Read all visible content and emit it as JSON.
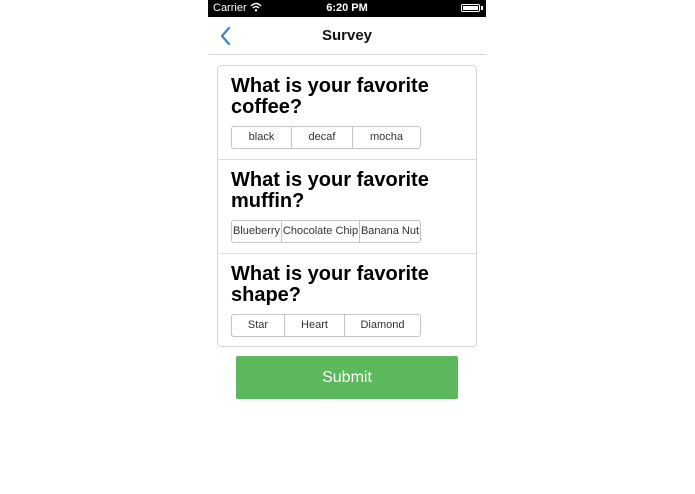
{
  "status_bar": {
    "carrier": "Carrier",
    "time": "6:20 PM",
    "wifi_icon": "wifi-icon",
    "battery_icon": "battery-icon"
  },
  "nav": {
    "title": "Survey",
    "back_icon": "chevron-left-icon"
  },
  "questions": [
    {
      "text": "What is your favorite coffee?",
      "options": [
        "black",
        "decaf",
        "mocha"
      ]
    },
    {
      "text": "What is your favorite muffin?",
      "options": [
        "Blueberry",
        "Chocolate Chip",
        "Banana Nut"
      ]
    },
    {
      "text": "What is your favorite shape?",
      "options": [
        "Star",
        "Heart",
        "Diamond"
      ]
    }
  ],
  "submit_label": "Submit",
  "colors": {
    "accent": "#3a82c4",
    "submit": "#5cb85c"
  }
}
